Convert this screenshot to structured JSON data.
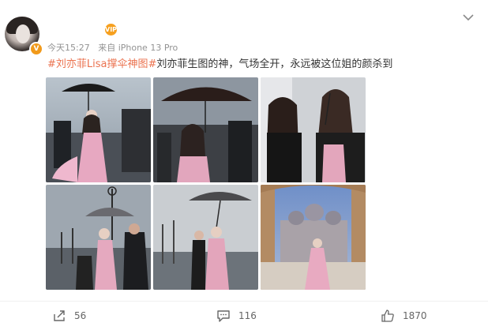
{
  "post": {
    "username": "　　　",
    "vip_badge": "VIP",
    "verified_badge": "V",
    "time": "今天15:27",
    "source": "来自 iPhone 13 Pro",
    "hashtag": "#刘亦菲Lisa撑伞神图#",
    "body": "刘亦菲生图的神，气场全开，永远被这位姐的颜杀到"
  },
  "actions": {
    "reposts": "56",
    "comments": "116",
    "likes": "1870"
  },
  "icons": {
    "more": "chevron-down-icon",
    "repost": "repost-icon",
    "comment": "comment-icon",
    "like": "thumbs-up-icon"
  },
  "colors": {
    "link": "#eb7350",
    "meta": "#939393",
    "verified": "#f19a1b"
  },
  "photos": [
    {
      "name": "photo-1"
    },
    {
      "name": "photo-2"
    },
    {
      "name": "photo-3"
    },
    {
      "name": "photo-4"
    },
    {
      "name": "photo-5"
    },
    {
      "name": "photo-6"
    }
  ]
}
